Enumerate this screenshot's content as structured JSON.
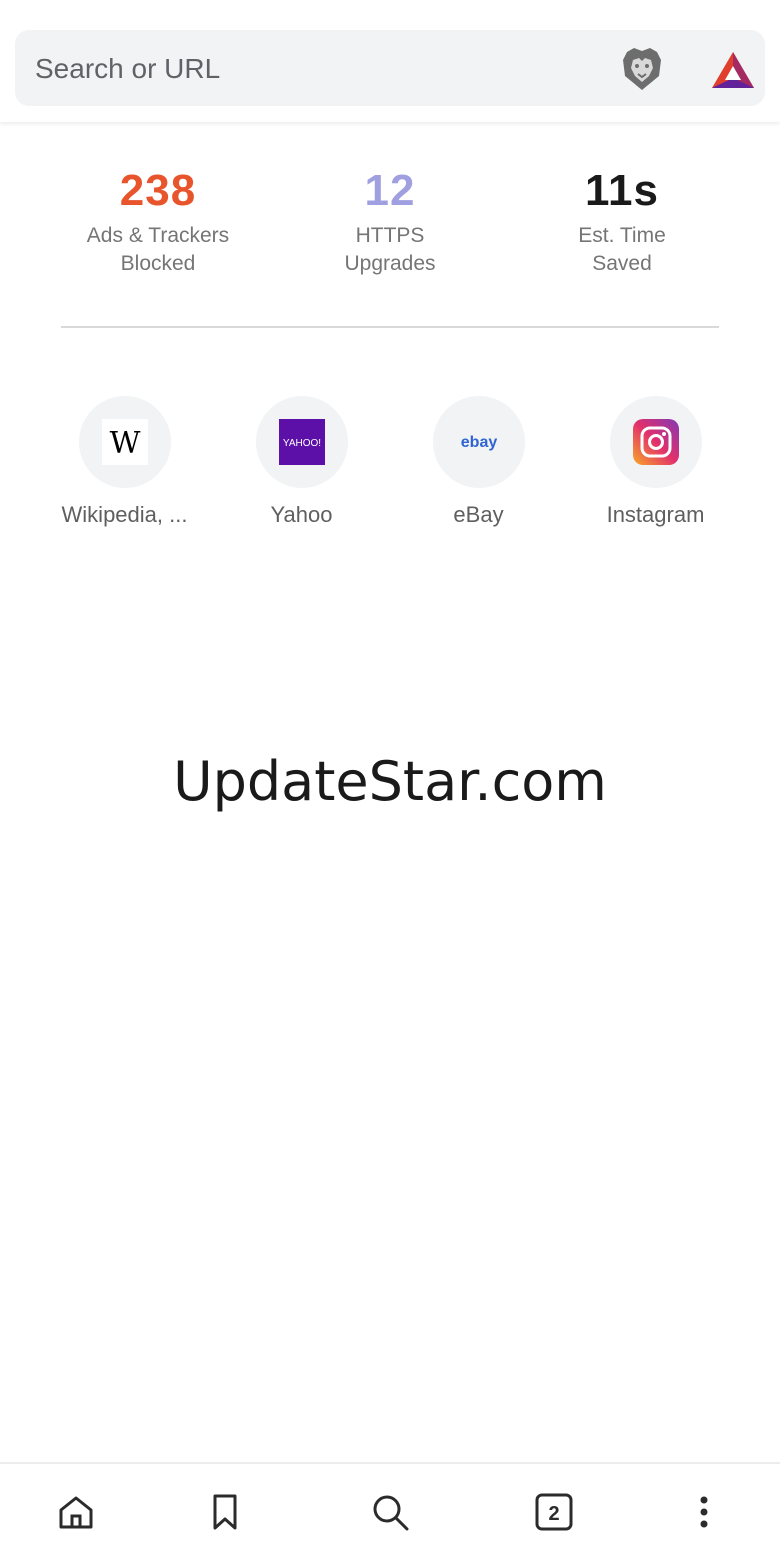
{
  "search": {
    "placeholder": "Search or URL"
  },
  "stats": [
    {
      "value": "238",
      "label_line1": "Ads & Trackers",
      "label_line2": "Blocked",
      "color": "#e8552d"
    },
    {
      "value": "12",
      "label_line1": "HTTPS",
      "label_line2": "Upgrades",
      "color": "#a0a0e0"
    },
    {
      "value": "11s",
      "label_line1": "Est. Time",
      "label_line2": "Saved",
      "color": "#1a1a1a"
    }
  ],
  "top_sites": [
    {
      "label": "Wikipedia, ...",
      "icon": "wikipedia-icon",
      "logo_text": "W"
    },
    {
      "label": "Yahoo",
      "icon": "yahoo-icon",
      "logo_text": "YAHOO!"
    },
    {
      "label": "eBay",
      "icon": "ebay-icon",
      "logo_text": "ebay"
    },
    {
      "label": "Instagram",
      "icon": "instagram-icon"
    }
  ],
  "watermark": "UpdateStar.com",
  "bottom_nav": {
    "tabs_count": "2",
    "items": [
      "home-icon",
      "bookmark-icon",
      "search-icon",
      "tabs-icon",
      "more-menu-icon"
    ]
  }
}
